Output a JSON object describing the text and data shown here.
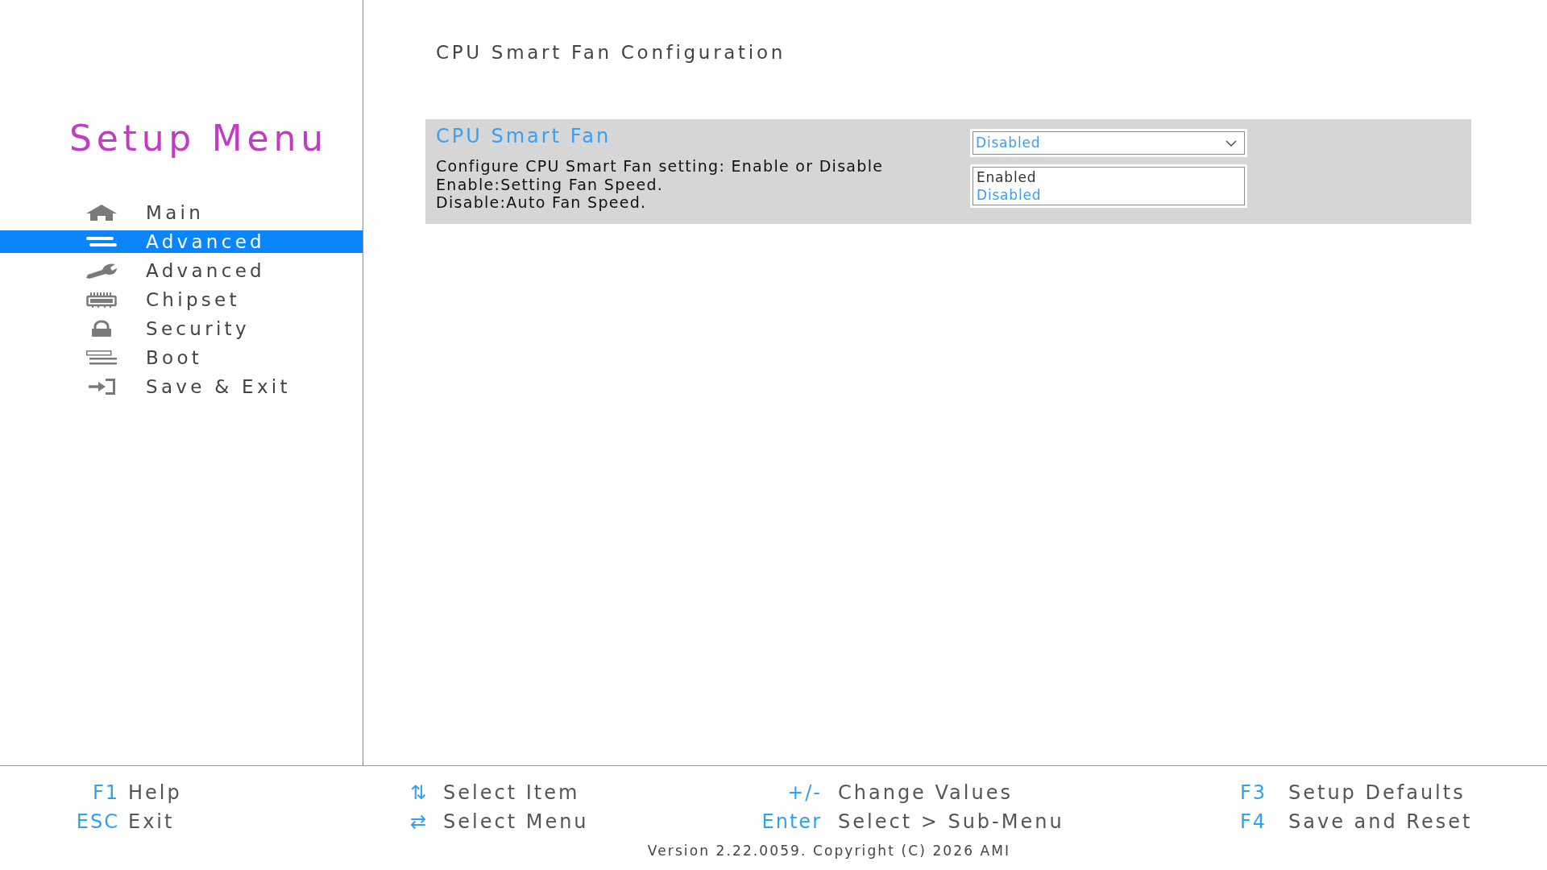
{
  "sidebar": {
    "title": "Setup Menu",
    "items": [
      {
        "label": "Main",
        "selected": false
      },
      {
        "label": "Advanced",
        "selected": true
      },
      {
        "label": "Advanced",
        "selected": false
      },
      {
        "label": "Chipset",
        "selected": false
      },
      {
        "label": "Security",
        "selected": false
      },
      {
        "label": "Boot",
        "selected": false
      },
      {
        "label": "Save & Exit",
        "selected": false
      }
    ]
  },
  "main": {
    "heading": "CPU Smart Fan Configuration",
    "settings": [
      {
        "name": "CPU Smart Fan",
        "help": [
          "Configure CPU Smart Fan setting: Enable or Disable",
          "Enable:Setting Fan Speed.",
          "Disable:Auto Fan Speed."
        ],
        "value": "Disabled",
        "expanded": true,
        "options": [
          {
            "label": "Enabled",
            "selected": false
          },
          {
            "label": "Disabled",
            "selected": true
          }
        ]
      }
    ]
  },
  "footer": {
    "hint_groups": [
      [
        {
          "key": "F1",
          "action": "Help"
        },
        {
          "key": "ESC",
          "action": "Exit"
        }
      ],
      [
        {
          "key": "⇅",
          "action": "Select Item"
        },
        {
          "key": "⇄",
          "action": "Select Menu"
        }
      ],
      [
        {
          "key": "+/-",
          "action": "Change Values"
        },
        {
          "key": "Enter",
          "action": "Select > Sub-Menu"
        }
      ],
      [
        {
          "key": "F3",
          "action": "Setup Defaults"
        },
        {
          "key": "F4",
          "action": "Save and Reset"
        }
      ]
    ],
    "version": "Version 2.22.0059. Copyright (C) 2026 AMI"
  }
}
